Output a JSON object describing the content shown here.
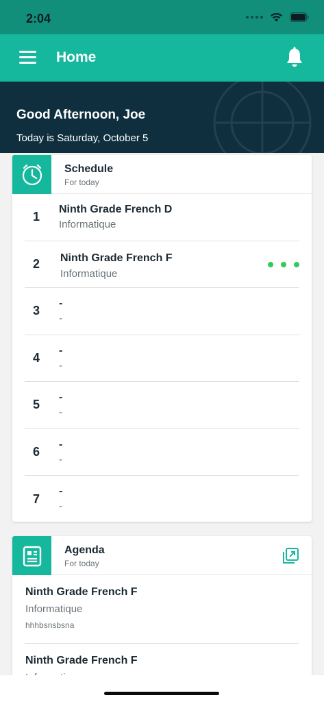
{
  "status_bar": {
    "time": "2:04"
  },
  "app_bar": {
    "title": "Home"
  },
  "hero": {
    "greeting": "Good Afternoon, Joe",
    "date_line": "Today is Saturday, October 5"
  },
  "schedule": {
    "title": "Schedule",
    "subtitle": "For today",
    "periods": [
      {
        "number": "1",
        "class_name": "Ninth Grade French D",
        "room": "Informatique"
      },
      {
        "number": "2",
        "class_name": "Ninth Grade French F",
        "room": "Informatique",
        "current": true
      },
      {
        "number": "3",
        "class_name": "-",
        "room": "-"
      },
      {
        "number": "4",
        "class_name": "-",
        "room": "-"
      },
      {
        "number": "5",
        "class_name": "-",
        "room": "-"
      },
      {
        "number": "6",
        "class_name": "-",
        "room": "-"
      },
      {
        "number": "7",
        "class_name": "-",
        "room": "-"
      }
    ]
  },
  "agenda": {
    "title": "Agenda",
    "subtitle": "For today",
    "items": [
      {
        "class_name": "Ninth Grade French F",
        "room": "Informatique",
        "note": "hhhbsnsbsna"
      },
      {
        "class_name": "Ninth Grade French F",
        "room": "Informatique",
        "note": ""
      }
    ]
  },
  "colors": {
    "accent": "#16b89d",
    "status_bar": "#128f7a",
    "hero_bg": "#0f2f3f",
    "live_dot": "#2ecc5b"
  },
  "icons": {
    "menu": "hamburger-menu-icon",
    "notifications": "bell-icon",
    "schedule": "clock-icon",
    "agenda": "agenda-icon",
    "expand": "open-external-icon"
  }
}
